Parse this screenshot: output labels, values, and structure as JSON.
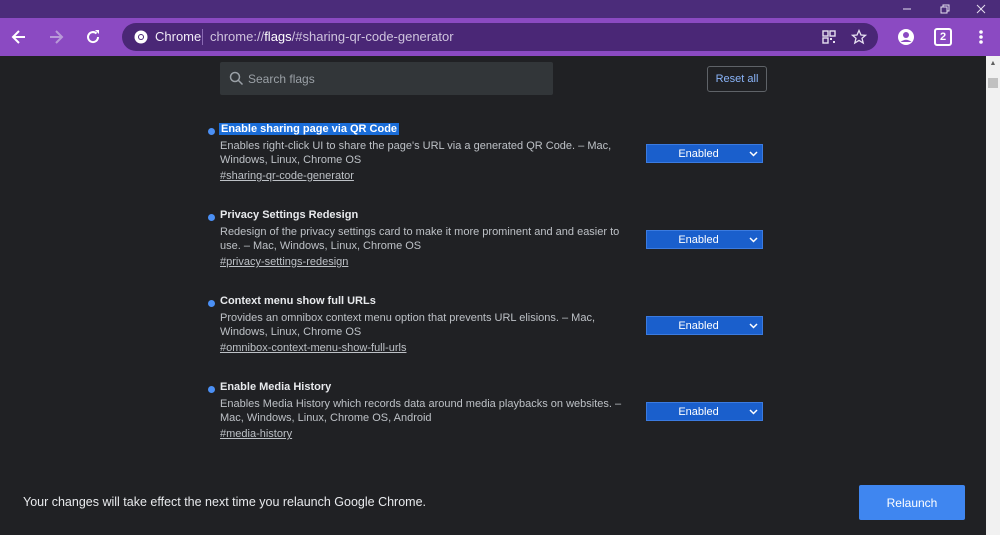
{
  "browser": {
    "chrome_label": "Chrome",
    "url_prefix": "chrome://",
    "url_host": "flags",
    "url_rest": "/#sharing-qr-code-generator",
    "tab_count": "2",
    "accent": "#8b4ac2"
  },
  "search": {
    "placeholder": "Search flags"
  },
  "reset_label": "Reset all",
  "flags": [
    {
      "title": "Enable sharing page via QR Code",
      "description": "Enables right-click UI to share the page's URL via a generated QR Code. – Mac, Windows, Linux, Chrome OS",
      "link": "#sharing-qr-code-generator",
      "value": "Enabled"
    },
    {
      "title": "Privacy Settings Redesign",
      "description": "Redesign of the privacy settings card to make it more prominent and and easier to use. – Mac, Windows, Linux, Chrome OS",
      "link": "#privacy-settings-redesign",
      "value": "Enabled"
    },
    {
      "title": "Context menu show full URLs",
      "description": "Provides an omnibox context menu option that prevents URL elisions. – Mac, Windows, Linux, Chrome OS",
      "link": "#omnibox-context-menu-show-full-urls",
      "value": "Enabled"
    },
    {
      "title": "Enable Media History",
      "description": "Enables Media History which records data around media playbacks on websites. – Mac, Windows, Linux, Chrome OS, Android",
      "link": "#media-history",
      "value": "Enabled"
    }
  ],
  "footer": {
    "message": "Your changes will take effect the next time you relaunch Google Chrome.",
    "relaunch_label": "Relaunch"
  }
}
